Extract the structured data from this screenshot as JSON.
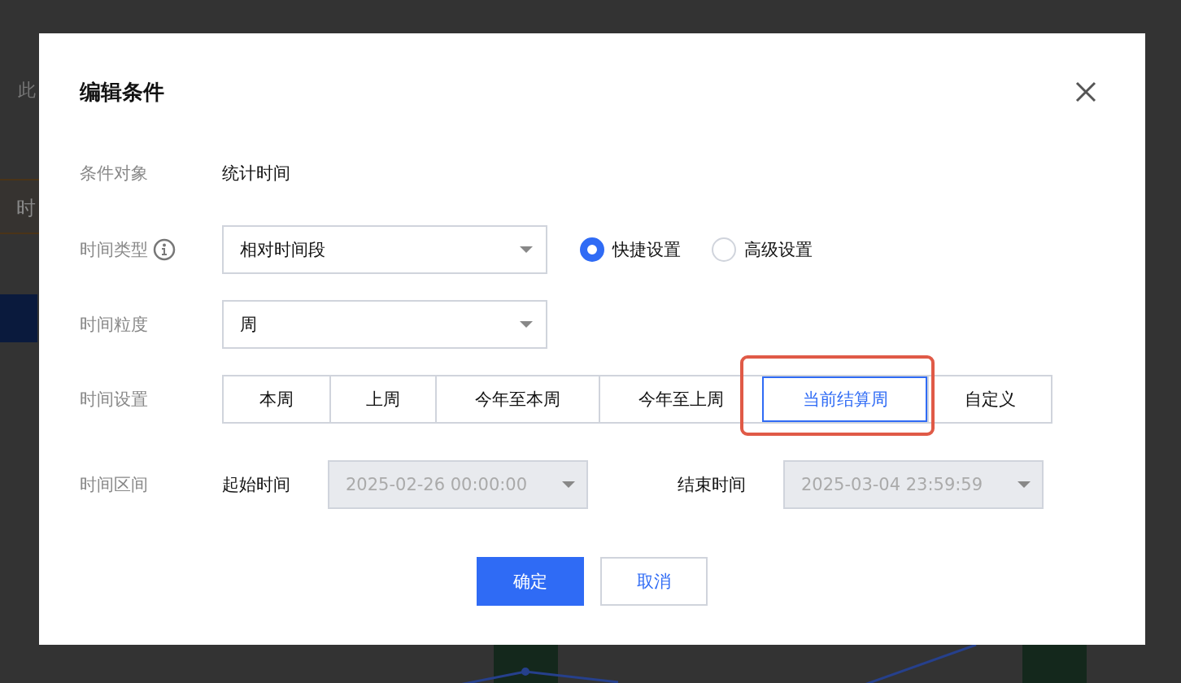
{
  "background": {
    "texts": [
      "此",
      "时"
    ]
  },
  "dialog": {
    "title": "编辑条件",
    "fields": [
      {
        "kind": "text",
        "label": "条件对象",
        "value": "统计时间"
      },
      {
        "kind": "select",
        "label": "时间类型",
        "info_icon": true,
        "value": "相对时间段",
        "radios": [
          {
            "label": "快捷设置",
            "selected": true
          },
          {
            "label": "高级设置",
            "selected": false
          }
        ]
      },
      {
        "kind": "select",
        "label": "时间粒度",
        "value": "周"
      },
      {
        "kind": "segmented",
        "label": "时间设置",
        "options": [
          {
            "label": "本周",
            "selected": false,
            "highlighted": false
          },
          {
            "label": "上周",
            "selected": false,
            "highlighted": false
          },
          {
            "label": "今年至本周",
            "selected": false,
            "highlighted": false
          },
          {
            "label": "今年至上周",
            "selected": false,
            "highlighted": false
          },
          {
            "label": "当前结算周",
            "selected": true,
            "highlighted": true
          },
          {
            "label": "自定义",
            "selected": false,
            "highlighted": false
          }
        ]
      },
      {
        "kind": "range",
        "label": "时间区间",
        "parts": [
          {
            "label": "起始时间",
            "value": "2025-02-26 00:00:00",
            "disabled": true
          },
          {
            "label": "结束时间",
            "value": "2025-03-04 23:59:59",
            "disabled": true
          }
        ]
      }
    ],
    "buttons": [
      {
        "label": "确定",
        "kind": "primary"
      },
      {
        "label": "取消",
        "kind": "secondary"
      }
    ]
  }
}
